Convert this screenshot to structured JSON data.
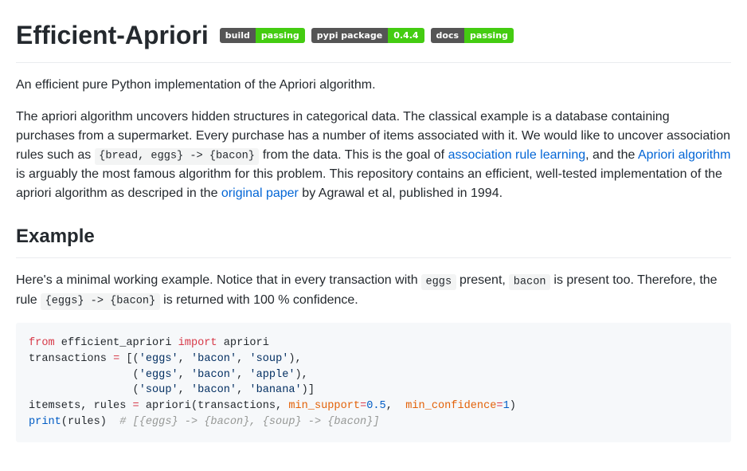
{
  "title": "Efficient-Apriori",
  "badges": [
    {
      "left": "build",
      "right": "passing",
      "rightClass": "bg-green"
    },
    {
      "left": "pypi package",
      "right": "0.4.4",
      "rightClass": "bg-green"
    },
    {
      "left": "docs",
      "right": "passing",
      "rightClass": "bg-green"
    }
  ],
  "intro": "An efficient pure Python implementation of the Apriori algorithm.",
  "desc": {
    "t1": "The apriori algorithm uncovers hidden structures in categorical data. The classical example is a database containing purchases from a supermarket. Every purchase has a number of items associated with it. We would like to uncover association rules such as ",
    "rule_code": "{bread, eggs} -> {bacon}",
    "t2": " from the data. This is the goal of ",
    "link1": "association rule learning",
    "t3": ", and the ",
    "link2": "Apriori algorithm",
    "t4": " is arguably the most famous algorithm for this problem. This repository contains an efficient, well-tested implementation of the apriori algorithm as descriped in the ",
    "link3": "original paper",
    "t5": " by Agrawal et al, published in 1994."
  },
  "example": {
    "heading": "Example",
    "p": {
      "t1": "Here's a minimal working example. Notice that in every transaction with ",
      "c1": "eggs",
      "t2": " present, ",
      "c2": "bacon",
      "t3": " is present too. Therefore, the rule ",
      "c3": "{eggs} -> {bacon}",
      "t4": " is returned with 100 % confidence."
    }
  },
  "code": {
    "kw_from": "from",
    "mod": " efficient_apriori ",
    "kw_import": "import",
    "fn_apriori": " apriori",
    "line2a": "transactions ",
    "op_eq": "=",
    "line2b": " [(",
    "s_eggs": "'eggs'",
    "s_bacon": "'bacon'",
    "s_soup": "'soup'",
    "s_apple": "'apple'",
    "s_banana": "'banana'",
    "sep": ", ",
    "close_tuple_comma": "),",
    "close_tuple_list": ")]",
    "indent": "                (",
    "line4a": "itemsets, rules ",
    "line4b": " apriori(transactions, ",
    "arg_ms": "min_support",
    "op_eq2": "=",
    "num05": "0.5",
    "sep2": ",  ",
    "arg_mc": "min_confidence",
    "num1": "1",
    "close_paren": ")",
    "print": "print",
    "print_arg": "(rules)  ",
    "comment": "# [{eggs} -> {bacon}, {soup} -> {bacon}]"
  }
}
